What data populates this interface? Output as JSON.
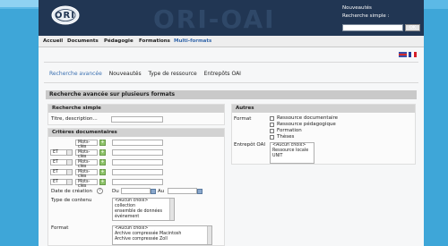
{
  "header": {
    "logo_text": "ORI",
    "watermark": "ORI-OAI",
    "news_label": "Nouveautés",
    "search_label": "Recherche simple :",
    "search_value": "",
    "ok_label": "OK"
  },
  "nav": {
    "items": [
      "Accueil",
      "Documents",
      "Pédagogie",
      "Formations",
      "Multi-formats"
    ],
    "active": "Multi-formats"
  },
  "subnav": {
    "items": [
      "Recherche avancée",
      "Nouveautés",
      "Type de ressource",
      "Entrepôts OAI"
    ]
  },
  "main_title": "Recherche avancée sur plusieurs formats",
  "simple_search": {
    "title": "Recherche simple",
    "label": "Titre, description..."
  },
  "criteria": {
    "title": "Critères documentaires",
    "rows": [
      {
        "op": "",
        "field": "Mots-clés"
      },
      {
        "op": "ET",
        "field": "Mots-clés"
      },
      {
        "op": "ET",
        "field": "Mots-clés"
      },
      {
        "op": "ET",
        "field": "Mots-clés"
      },
      {
        "op": "ET",
        "field": "Mots-clés"
      }
    ],
    "add_symbol": "+",
    "date_label": "Date de création",
    "date_from": "Du",
    "date_to": "Au",
    "content_type_label": "Type de contenu",
    "content_types": [
      "<Aucun choix>",
      "collection",
      "ensemble de données",
      "événement"
    ],
    "format_label": "Format",
    "formats": [
      "<Aucun choix>",
      "Archive compressée Macintosh",
      "Archive compressée Zoll"
    ]
  },
  "autres": {
    "title": "Autres",
    "format_label": "Format",
    "format_options": [
      "Ressource documentaire",
      "Ressource pédagogique",
      "Formation",
      "Thèses"
    ],
    "entrepot_label": "Entrepôt OAI",
    "entrepots": [
      "<Aucun choix>",
      "Ressource locale",
      "UNIT"
    ]
  },
  "colors": {
    "header_bg": "#213653",
    "page_bg": "#3ea6d8",
    "add_button": "#8fc46a"
  }
}
